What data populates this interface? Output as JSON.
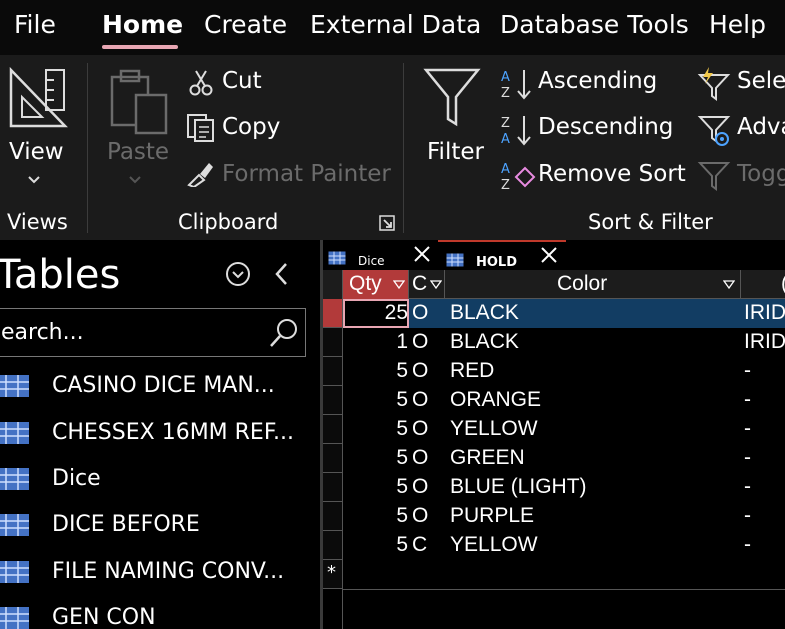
{
  "menu": {
    "file": "File",
    "home": "Home",
    "create": "Create",
    "external": "External Data",
    "dbtools": "Database Tools",
    "help": "Help"
  },
  "ribbon": {
    "views": {
      "view_label": "View",
      "group": "Views"
    },
    "clipboard": {
      "paste": "Paste",
      "cut": "Cut",
      "copy": "Copy",
      "format_painter": "Format Painter",
      "group": "Clipboard"
    },
    "sortfilter": {
      "filter": "Filter",
      "ascending": "Ascending",
      "descending": "Descending",
      "remove_sort": "Remove Sort",
      "selection": "Selec",
      "advanced": "Adva",
      "toggle": "Togg",
      "group": "Sort & Filter"
    }
  },
  "nav": {
    "title": "Tables",
    "search_placeholder": "earch...",
    "items": [
      "CASINO DICE MAN...",
      "CHESSEX 16MM REF...",
      "Dice",
      "DICE BEFORE",
      "FILE NAMING CONV...",
      "GEN CON"
    ]
  },
  "tabs": [
    {
      "label": "Dice",
      "active": false
    },
    {
      "label": "HOLD",
      "active": true
    }
  ],
  "grid": {
    "columns": [
      "Qty",
      "C",
      "Color",
      "("
    ],
    "rows": [
      {
        "qty": "25",
        "c": "O",
        "color": "BLACK",
        "extra": "IRID",
        "selected": true
      },
      {
        "qty": "1",
        "c": "O",
        "color": "BLACK",
        "extra": "IRID"
      },
      {
        "qty": "5",
        "c": "O",
        "color": "RED",
        "extra": "-"
      },
      {
        "qty": "5",
        "c": "O",
        "color": "ORANGE",
        "extra": "-"
      },
      {
        "qty": "5",
        "c": "O",
        "color": "YELLOW",
        "extra": "-"
      },
      {
        "qty": "5",
        "c": "O",
        "color": "GREEN",
        "extra": "-"
      },
      {
        "qty": "5",
        "c": "O",
        "color": "BLUE (LIGHT)",
        "extra": "-"
      },
      {
        "qty": "5",
        "c": "O",
        "color": "PURPLE",
        "extra": "-"
      },
      {
        "qty": "5",
        "c": "C",
        "color": "YELLOW",
        "extra": "-"
      }
    ],
    "new_row_marker": "*"
  },
  "colors": {
    "accent": "#e8a6b3",
    "selected_row": "#123d63",
    "sorted_header": "#b23a3a"
  }
}
